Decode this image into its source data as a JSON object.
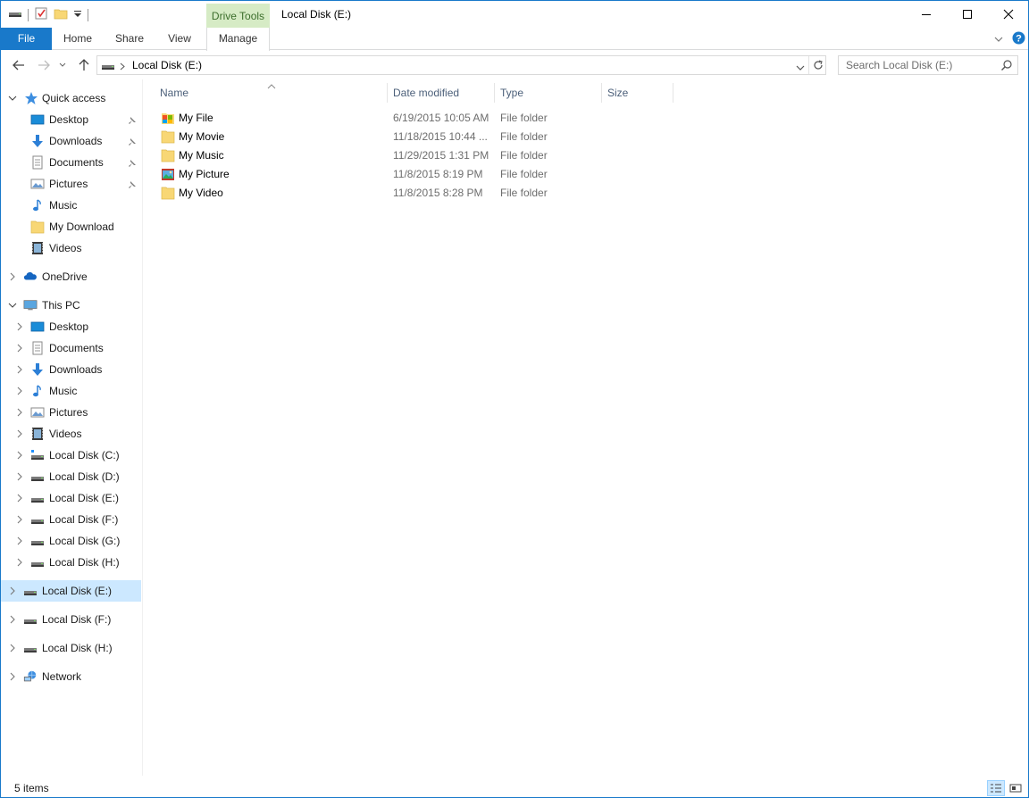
{
  "titlebar": {
    "title": "Local Disk (E:)",
    "context_tab_group": "Drive Tools",
    "minimize_glyph": "—",
    "maximize_glyph": "☐",
    "close_glyph": "✕"
  },
  "ribbon": {
    "tabs": [
      {
        "label": "File"
      },
      {
        "label": "Home"
      },
      {
        "label": "Share"
      },
      {
        "label": "View"
      },
      {
        "label": "Manage"
      }
    ]
  },
  "address": {
    "path": "Local Disk (E:)",
    "search_placeholder": "Search Local Disk (E:)"
  },
  "navpane": {
    "items": [
      {
        "label": "Quick access",
        "icon": "star-icon"
      },
      {
        "label": "Desktop",
        "icon": "desktop-icon"
      },
      {
        "label": "Downloads",
        "icon": "download-icon"
      },
      {
        "label": "Documents",
        "icon": "documents-icon"
      },
      {
        "label": "Pictures",
        "icon": "pictures-icon"
      },
      {
        "label": "Music",
        "icon": "music-icon"
      },
      {
        "label": "My Download",
        "icon": "folder-icon"
      },
      {
        "label": "Videos",
        "icon": "videos-icon"
      },
      {
        "label": "OneDrive",
        "icon": "onedrive-icon"
      },
      {
        "label": "This PC",
        "icon": "computer-icon"
      },
      {
        "label": "Desktop",
        "icon": "desktop-icon"
      },
      {
        "label": "Documents",
        "icon": "documents-icon"
      },
      {
        "label": "Downloads",
        "icon": "download-icon"
      },
      {
        "label": "Music",
        "icon": "music-icon"
      },
      {
        "label": "Pictures",
        "icon": "pictures-icon"
      },
      {
        "label": "Videos",
        "icon": "videos-icon"
      },
      {
        "label": "Local Disk (C:)",
        "icon": "system-drive-icon"
      },
      {
        "label": "Local Disk (D:)",
        "icon": "drive-icon"
      },
      {
        "label": "Local Disk (E:)",
        "icon": "drive-icon"
      },
      {
        "label": "Local Disk (F:)",
        "icon": "drive-icon"
      },
      {
        "label": "Local Disk (G:)",
        "icon": "drive-icon"
      },
      {
        "label": "Local Disk (H:)",
        "icon": "drive-icon"
      },
      {
        "label": "Local Disk (E:)",
        "icon": "drive-icon"
      },
      {
        "label": "Local Disk (F:)",
        "icon": "drive-icon"
      },
      {
        "label": "Local Disk (H:)",
        "icon": "drive-icon"
      },
      {
        "label": "Network",
        "icon": "network-icon"
      }
    ]
  },
  "columns": {
    "name": "Name",
    "date_modified": "Date modified",
    "type": "Type",
    "size": "Size"
  },
  "files": [
    {
      "name": "My File",
      "date": "6/19/2015 10:05 AM",
      "type": "File folder",
      "icon": "custom-folder-icon"
    },
    {
      "name": "My Movie",
      "date": "11/18/2015 10:44 ...",
      "type": "File folder",
      "icon": "folder-icon"
    },
    {
      "name": "My Music",
      "date": "11/29/2015 1:31 PM",
      "type": "File folder",
      "icon": "folder-icon"
    },
    {
      "name": "My Picture",
      "date": "11/8/2015 8:19 PM",
      "type": "File folder",
      "icon": "picture-folder-icon"
    },
    {
      "name": "My Video",
      "date": "11/8/2015 8:28 PM",
      "type": "File folder",
      "icon": "folder-icon"
    }
  ],
  "status": {
    "item_count": "5 items"
  },
  "colors": {
    "accent": "#1979ca",
    "drive_tools_bg": "#d6ebc5",
    "selected_bg": "#cce8ff",
    "header_text": "#4c607a",
    "folder": "#f8d775"
  }
}
